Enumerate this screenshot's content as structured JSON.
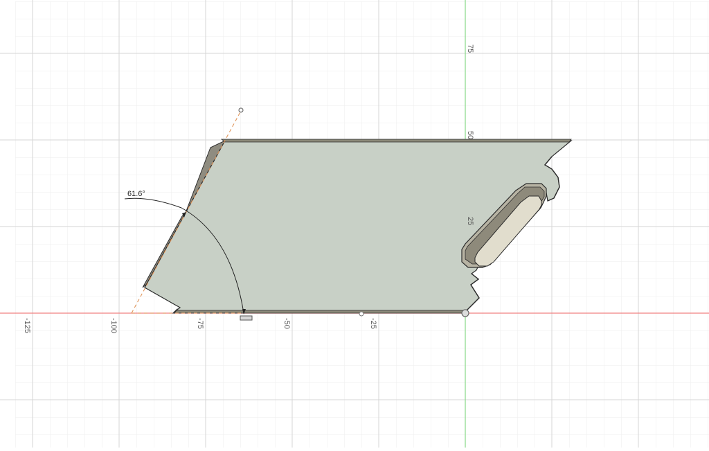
{
  "canvas": {
    "x_axis_ticks": [
      "-125",
      "-100",
      "-75",
      "-50",
      "-25"
    ],
    "y_axis_ticks": [
      "75",
      "50",
      "25"
    ],
    "colors": {
      "background": "#ffffff",
      "grid_minor": "#ececec",
      "grid_major": "#d4d4d4",
      "x_axis": "#ef6f6f",
      "y_axis": "#7fd67f",
      "sheet_face": "#c9d1c6",
      "sheet_edge": "#8b8778",
      "slot_fill": "#e0dccd",
      "construction_line": "#e0955a"
    }
  },
  "dimension": {
    "angle_label": "61.6°"
  },
  "icons": {
    "origin": "origin-marker-icon",
    "sketch_dimension": "dimension-glyph-icon"
  }
}
